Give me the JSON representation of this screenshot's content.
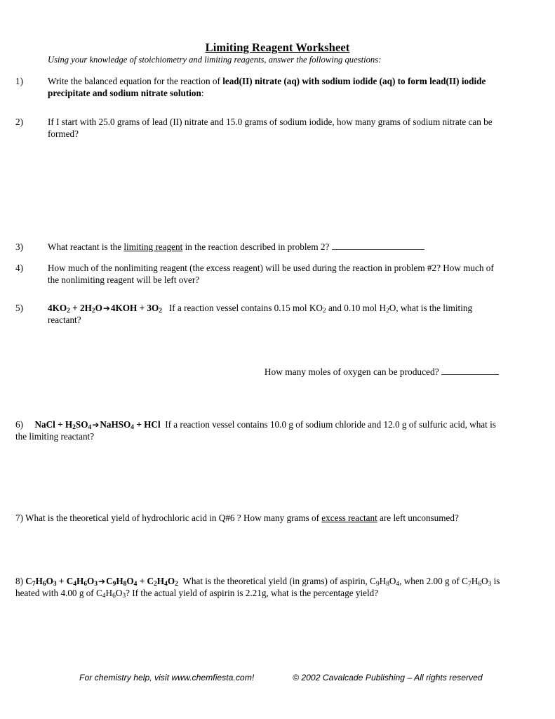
{
  "document": {
    "title": "Limiting Reagent Worksheet",
    "subtitle": "Using your knowledge of stoichiometry and limiting reagents, answer the following questions:"
  },
  "questions": {
    "q1": {
      "number": "1)",
      "lead": "Write the balanced equation for the reaction of ",
      "bold": "lead(II) nitrate (aq) with sodium iodide (aq) to form  lead(II) iodide precipitate and sodium nitrate solution",
      "tail": ":"
    },
    "q2": {
      "number": "2)",
      "text": "If I start with 25.0 grams of lead (II) nitrate and 15.0 grams of sodium iodide, how many grams of sodium nitrate can be formed?"
    },
    "q3": {
      "number": "3)",
      "lead": "What reactant is the ",
      "underlined": "limiting reagent",
      "tail": " in the reaction described in problem 2? "
    },
    "q4": {
      "number": "4)",
      "text": "How much of the nonlimiting reagent (the excess reagent) will be used during the reaction in problem #2? How much of the nonlimiting reagent will be left over?"
    },
    "q5": {
      "number": "5)",
      "equation_reactant_1_coeff": "4KO",
      "equation_reactant_1_sub": "2",
      "plus_1": " + ",
      "equation_reactant_2_a": "2H",
      "equation_reactant_2_sub": "2",
      "equation_reactant_2_b": "O",
      "arrow": "➔",
      "equation_product_1": "4KOH",
      "plus_2": " + ",
      "equation_product_2_a": "3O",
      "equation_product_2_sub": "2",
      "text_a": "If a reaction vessel contains 0.15 mol KO",
      "text_a_sub": "2",
      "text_b": " and 0.10 mol H",
      "text_b_sub": "2",
      "text_c": "O, what is the limiting reactant?",
      "followup": "How many moles of oxygen can be produced? "
    },
    "q6": {
      "number": "6)",
      "eq_r1": "NaCl",
      "plus_1": " + ",
      "eq_r2_a": "H",
      "eq_r2_sub1": "2",
      "eq_r2_b": "SO",
      "eq_r2_sub2": "4",
      "arrow": "➔",
      "eq_p1_a": "NaHSO",
      "eq_p1_sub": "4",
      "plus_2": " + ",
      "eq_p2": "HCl",
      "text": "If a reaction vessel contains 10.0 g of sodium chloride and 12.0 g of sulfuric acid, what is the limiting reactant?"
    },
    "q7": {
      "number": "7)",
      "lead": " What is the theoretical yield of hydrochloric acid in Q#6 ? How many grams of ",
      "underlined": "excess reactant",
      "tail": " are left unconsumed?"
    },
    "q8": {
      "number": "8)",
      "eq_r1_a": "C",
      "eq_r1_s1": "7",
      "eq_r1_b": "H",
      "eq_r1_s2": "6",
      "eq_r1_c": "O",
      "eq_r1_s3": "3",
      "plus_1": " + ",
      "eq_r2_a": "C",
      "eq_r2_s1": "4",
      "eq_r2_b": "H",
      "eq_r2_s2": "6",
      "eq_r2_c": "O",
      "eq_r2_s3": "3",
      "arrow": "➔",
      "eq_p1_a": "C",
      "eq_p1_s1": "9",
      "eq_p1_b": "H",
      "eq_p1_s2": "8",
      "eq_p1_c": "O",
      "eq_p1_s3": "4",
      "plus_2": " + ",
      "eq_p2_a": "C",
      "eq_p2_s1": "2",
      "eq_p2_b": "H",
      "eq_p2_s2": "4",
      "eq_p2_c": "O",
      "eq_p2_s3": "2",
      "t1": "What is the theoretical yield (in grams) of aspirin, C",
      "t1s1": "9",
      "t1b": "H",
      "t1s2": "8",
      "t1c": "O",
      "t1s3": "4",
      "t2": ", when 2.00 g of C",
      "t2s1": "7",
      "t2b": "H",
      "t2s2": "6",
      "t2c": "O",
      "t2s3": "3",
      "t3": " is heated with 4.00 g of C",
      "t3s1": "4",
      "t3b": "H",
      "t3s2": "6",
      "t3c": "O",
      "t3s3": "3",
      "t4": "? If the actual yield of aspirin is 2.21g, what is the percentage yield?"
    }
  },
  "footer": {
    "left": "For chemistry help, visit www.chemfiesta.com!",
    "right": "© 2002 Cavalcade Publishing – All rights reserved"
  }
}
